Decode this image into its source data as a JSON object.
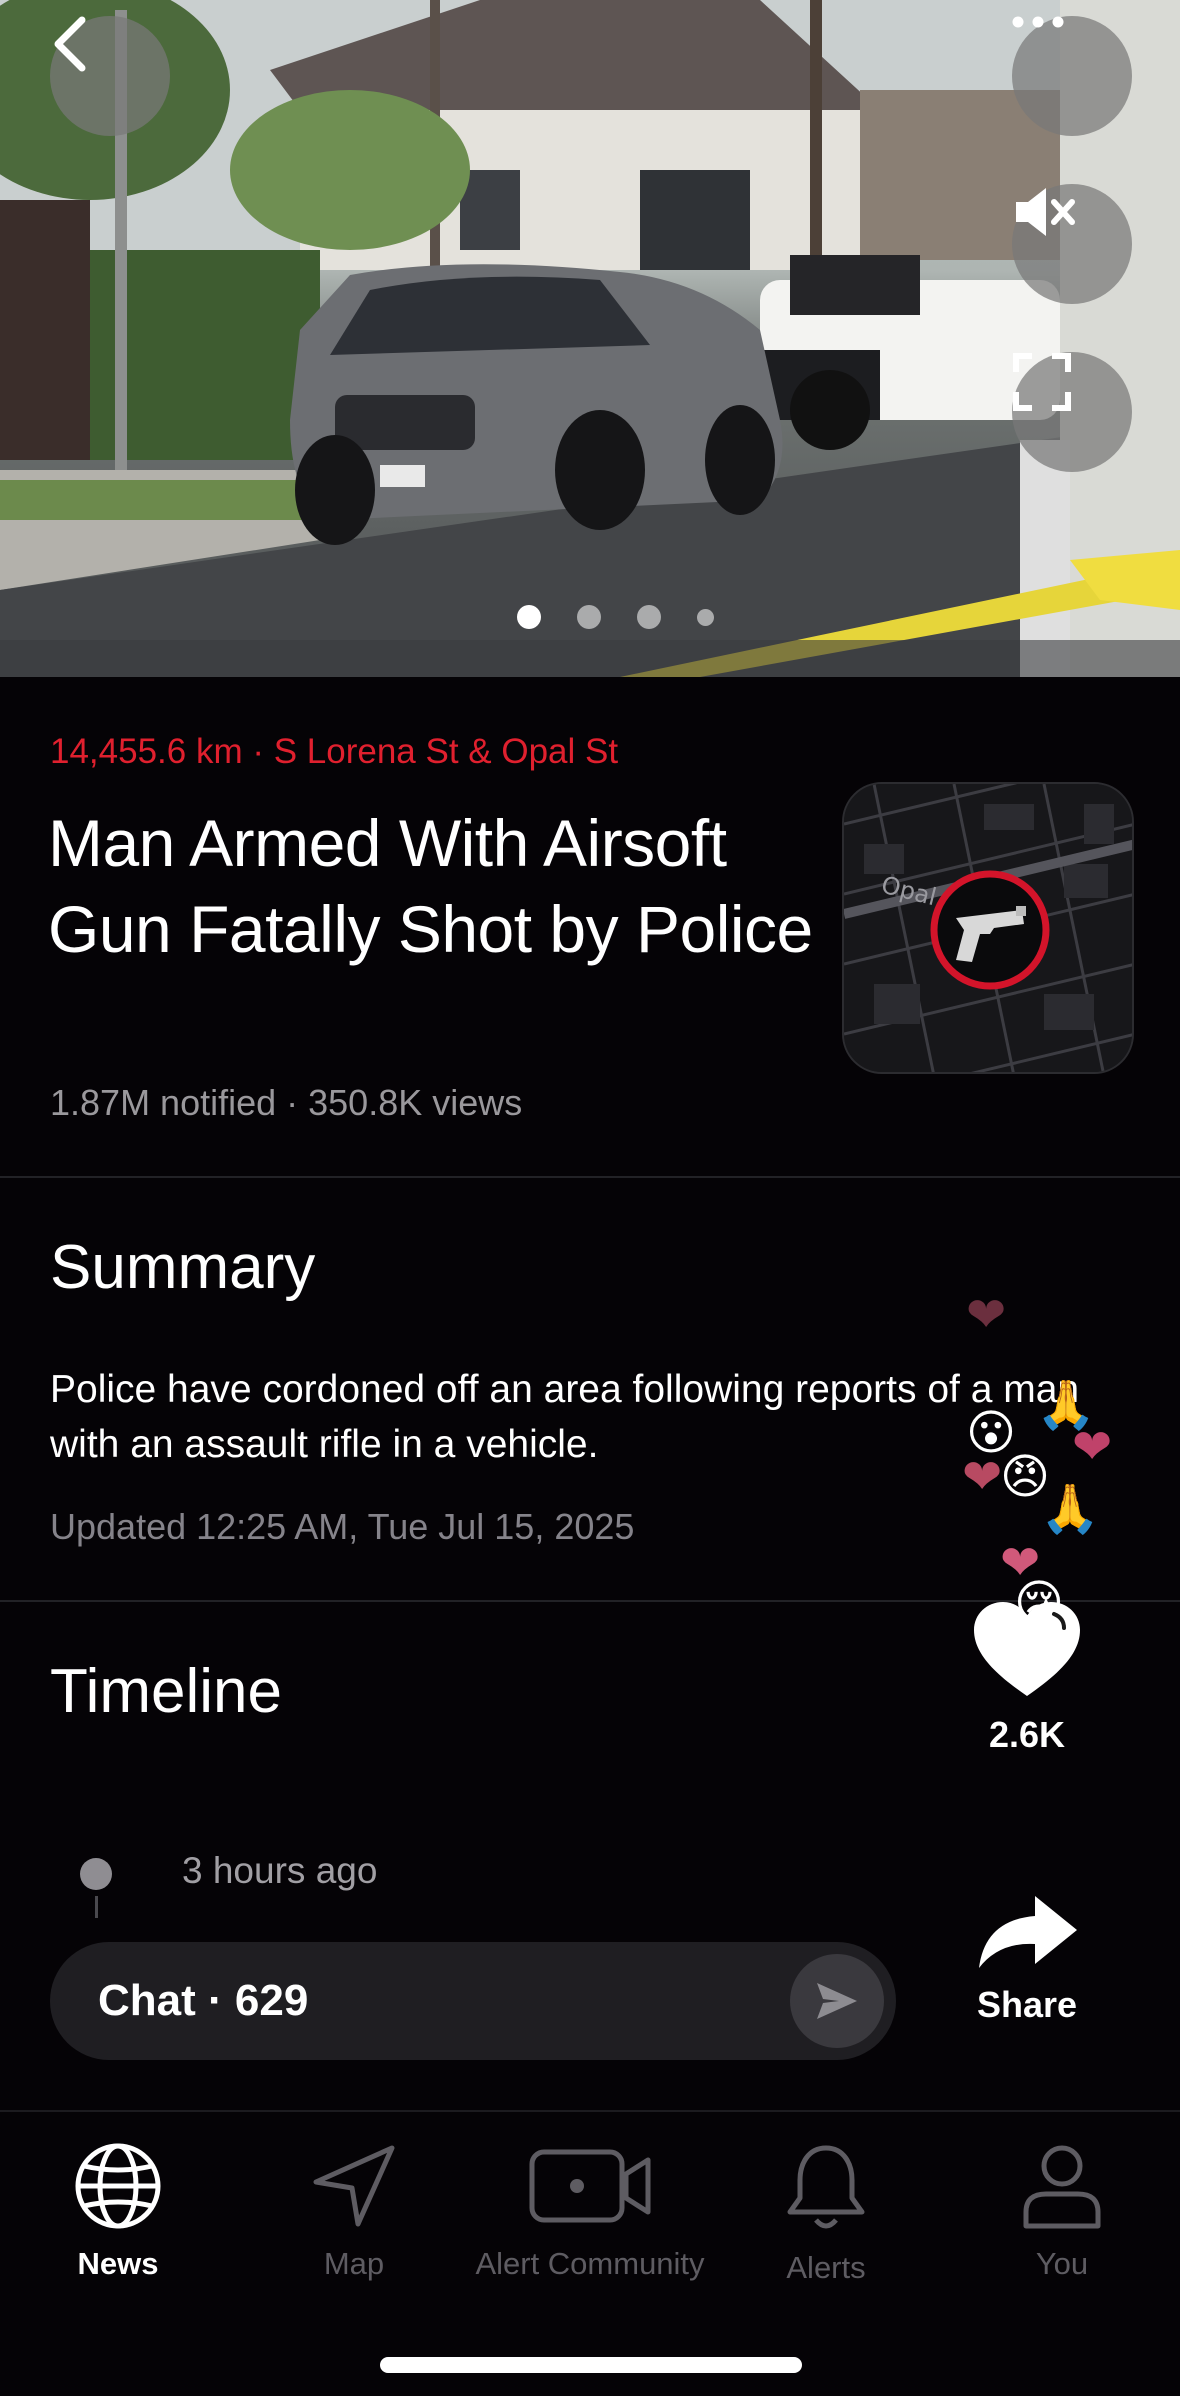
{
  "hero": {
    "carousel_count": 4,
    "carousel_active": 0
  },
  "incident": {
    "distance_location": "14,455.6 km · S Lorena St & Opal St",
    "title": "Man Armed With Airsoft Gun Fatally Shot by Police",
    "meta": "1.87M notified · 350.8K views",
    "map_label": "Opal"
  },
  "summary": {
    "heading": "Summary",
    "text": "Police have cordoned off an area following reports of a man with an assault rifle in a vehicle.",
    "updated": "Updated 12:25 AM, Tue Jul 15, 2025"
  },
  "timeline": {
    "heading": "Timeline",
    "items": [
      {
        "time": "3 hours ago"
      }
    ]
  },
  "reactions": {
    "like_count": "2.6K",
    "share_label": "Share"
  },
  "chat": {
    "label": "Chat · 629"
  },
  "tabs": [
    {
      "label": "News",
      "icon": "globe-icon",
      "active": true
    },
    {
      "label": "Map",
      "icon": "navigation-arrow-icon",
      "active": false
    },
    {
      "label": "Alert Community",
      "icon": "video-camera-icon",
      "active": false
    },
    {
      "label": "Alerts",
      "icon": "bell-icon",
      "active": false
    },
    {
      "label": "You",
      "icon": "person-icon",
      "active": false
    }
  ],
  "colors": {
    "accent_red": "#e0202e",
    "background": "#050306"
  }
}
